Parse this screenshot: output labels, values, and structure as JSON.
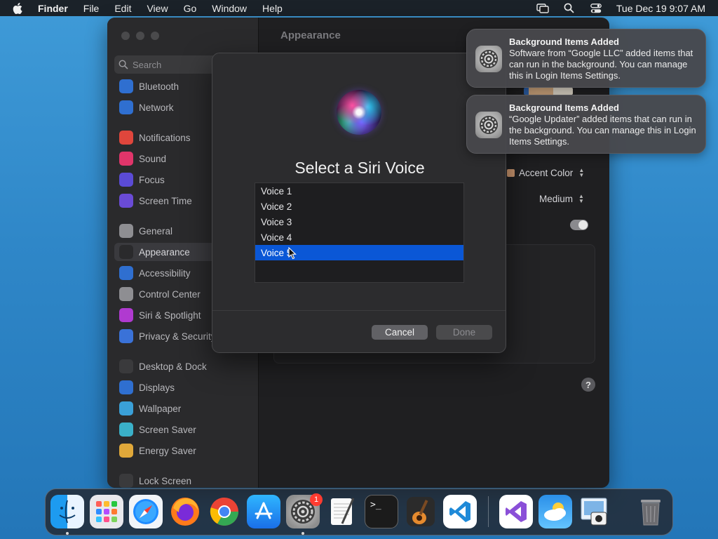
{
  "menubar": {
    "app_name": "Finder",
    "items": [
      "File",
      "Edit",
      "View",
      "Go",
      "Window",
      "Help"
    ],
    "clock": "Tue Dec 19  9:07 AM"
  },
  "settings": {
    "search_placeholder": "Search",
    "title": "Appearance",
    "sidebar": [
      {
        "label": "Bluetooth",
        "icon": "bluetooth-icon",
        "color": "#2f6fd0"
      },
      {
        "label": "Network",
        "icon": "globe-icon",
        "color": "#2f6fd0"
      },
      {
        "label": "Notifications",
        "icon": "bell-icon",
        "color": "#e0463c"
      },
      {
        "label": "Sound",
        "icon": "speaker-icon",
        "color": "#e0356a"
      },
      {
        "label": "Focus",
        "icon": "moon-icon",
        "color": "#5b4bd6"
      },
      {
        "label": "Screen Time",
        "icon": "hourglass-icon",
        "color": "#6a4bd6"
      },
      {
        "label": "General",
        "icon": "gear-icon",
        "color": "#8e8e92"
      },
      {
        "label": "Appearance",
        "icon": "appearance-icon",
        "color": "#2a2a2c"
      },
      {
        "label": "Accessibility",
        "icon": "accessibility-icon",
        "color": "#2f6fd0"
      },
      {
        "label": "Control Center",
        "icon": "control-center-icon",
        "color": "#8e8e92"
      },
      {
        "label": "Siri & Spotlight",
        "icon": "siri-icon",
        "color": "#b03ad0"
      },
      {
        "label": "Privacy & Security",
        "icon": "hand-icon",
        "color": "#3a72d8"
      },
      {
        "label": "Desktop & Dock",
        "icon": "dock-icon",
        "color": "#3a3a3c"
      },
      {
        "label": "Displays",
        "icon": "sun-icon",
        "color": "#2f6fd0"
      },
      {
        "label": "Wallpaper",
        "icon": "flower-icon",
        "color": "#3aa0d8"
      },
      {
        "label": "Screen Saver",
        "icon": "screensaver-icon",
        "color": "#3ab0c8"
      },
      {
        "label": "Energy Saver",
        "icon": "bulb-icon",
        "color": "#e0a83a"
      },
      {
        "label": "Lock Screen",
        "icon": "lock-icon",
        "color": "#3a3a3c"
      }
    ],
    "accent_color_label": "Accent Color",
    "sidebar_icon_size": "Medium"
  },
  "dialog": {
    "title": "Select a Siri Voice",
    "voices": [
      "Voice 1",
      "Voice 2",
      "Voice 3",
      "Voice 4",
      "Voice 5"
    ],
    "selected_index": 4,
    "cancel_label": "Cancel",
    "done_label": "Done"
  },
  "notifications": [
    {
      "title": "Background Items Added",
      "body": "Software from “Google LLC” added items that can run in the background. You can manage this in Login Items Settings."
    },
    {
      "title": "Background Items Added",
      "body": "“Google Updater” added items that can run in the background. You can manage this in Login Items Settings."
    }
  ],
  "dock": {
    "apps": [
      {
        "name": "Finder",
        "icon": "finder-icon"
      },
      {
        "name": "Launchpad",
        "icon": "launchpad-icon"
      },
      {
        "name": "Safari",
        "icon": "safari-icon"
      },
      {
        "name": "Firefox",
        "icon": "firefox-icon"
      },
      {
        "name": "Chrome",
        "icon": "chrome-icon"
      },
      {
        "name": "App Store",
        "icon": "app-store-icon"
      },
      {
        "name": "System Settings",
        "icon": "system-settings-icon",
        "badge": "1"
      },
      {
        "name": "TextEdit",
        "icon": "textedit-icon"
      },
      {
        "name": "Terminal",
        "icon": "terminal-icon"
      },
      {
        "name": "GarageBand",
        "icon": "garageband-icon"
      },
      {
        "name": "Visual Studio Code",
        "icon": "vscode-icon"
      },
      {
        "name": "Visual Studio",
        "icon": "visual-studio-icon"
      },
      {
        "name": "Weather",
        "icon": "weather-icon"
      },
      {
        "name": "Preview",
        "icon": "preview-icon"
      },
      {
        "name": "Trash",
        "icon": "trash-icon"
      }
    ],
    "terminal_prompt": ">_"
  }
}
